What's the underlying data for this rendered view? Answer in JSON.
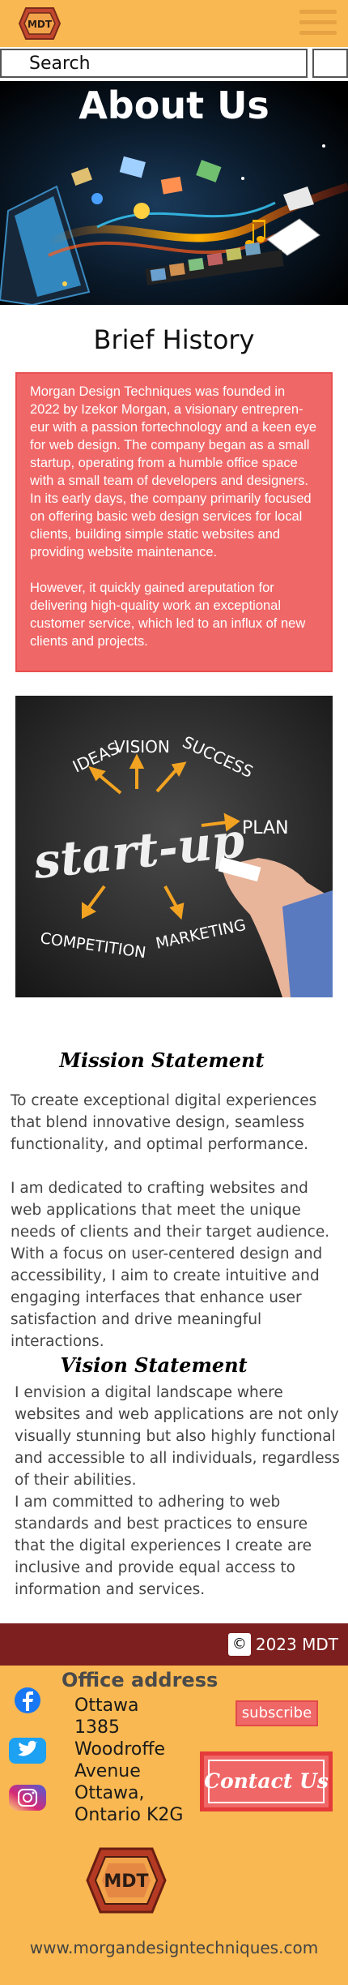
{
  "header": {
    "logo_text": "MDT",
    "menu_icon": "hamburger-menu-icon"
  },
  "search": {
    "placeholder": "Search"
  },
  "hero": {
    "title": "About Us"
  },
  "brief_history": {
    "title": "Brief History",
    "paragraph1": "Morgan Design Techniques was founded in 2022 by Izekor Morgan, a visionary entrepren-eur with a passion fortechnology and a keen eye for web design. The company began as a small startup, operating from a humble office space with a small team of developers and designers. In its early days, the company primarily focused on offering basic web design services for local clients, building simple static websites and providing website maintenance.",
    "paragraph2": "However, it quickly gained areputation for delivering high-quality work an exceptional customer service, which led to an influx of new clients and projects."
  },
  "startup_image": {
    "words": [
      "IDEAS",
      "VISION",
      "SUCCESS",
      "PLAN",
      "start-up",
      "COMPETITION",
      "MARKETING"
    ]
  },
  "mission": {
    "title": "Mission Statement",
    "paragraph1": "To create exceptional digital experiences that blend innovative design, seamless functionality, and optimal performance.",
    "paragraph2": "I am dedicated to crafting websites and web applications that meet the unique needs of clients and their target audience. With a focus on user-centered design and accessibility, I aim to create intuitive and engaging interfaces that enhance user satisfaction and drive meaningful interactions."
  },
  "vision": {
    "title": "Vision Statement",
    "paragraph1": "I envision a digital landscape where websites and web applications are not only visually stunning but also highly functional and accessible to all individuals, regardless of their abilities.",
    "paragraph2": "I am committed to adhering to web standards and best practices to ensure that the digital experiences I create are inclusive and provide equal access to information and services."
  },
  "footer": {
    "copyright_symbol": "©",
    "copyright_text": "2023 MDT",
    "office_title": "Office address",
    "address_lines": [
      "Ottawa",
      "1385",
      "Woodroffe",
      "Avenue",
      "Ottawa,",
      "Ontario K2G"
    ],
    "subscribe_label": "subscribe",
    "contact_label": "Contact Us",
    "logo_text": "MDT",
    "website": "www.morgandesigntechniques.com",
    "social_icons": [
      "facebook-icon",
      "twitter-icon",
      "instagram-icon"
    ]
  },
  "colors": {
    "header_bg": "#f9b851",
    "accent_red": "#f06767",
    "dark_maroon": "#7d1f1f"
  }
}
